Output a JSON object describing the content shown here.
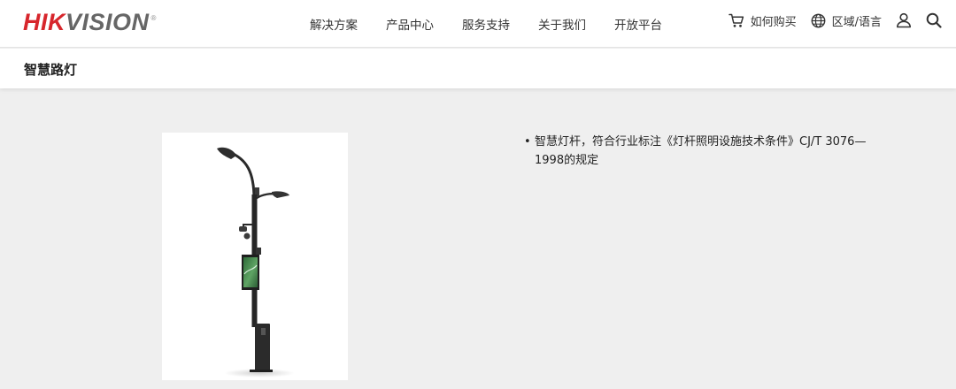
{
  "header": {
    "logo_part1": "HIK",
    "logo_part2": "VISION",
    "logo_reg": "®",
    "nav": [
      {
        "label": "解决方案"
      },
      {
        "label": "产品中心"
      },
      {
        "label": "服务支持"
      },
      {
        "label": "关于我们"
      },
      {
        "label": "开放平台"
      }
    ],
    "buy_label": "如何购买",
    "region_label": "区域/语言"
  },
  "page": {
    "title": "智慧路灯"
  },
  "product": {
    "image_icon": "smart-street-lamp-image",
    "description_items": [
      "智慧灯杆，符合行业标注《灯杆照明设施技术条件》CJ/T 3076—1998的规定"
    ]
  },
  "colors": {
    "brand_red": "#d7262c",
    "page_bg": "#efefef"
  }
}
